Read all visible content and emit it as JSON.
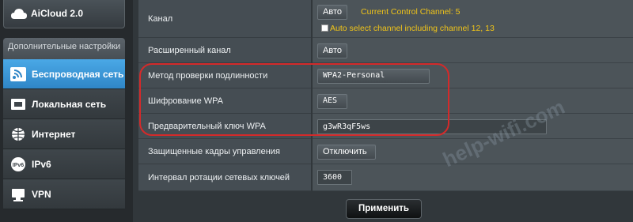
{
  "sidebar": {
    "aicloud_label": "AiCloud 2.0",
    "advanced_label": "Дополнительные настройки",
    "items": [
      {
        "label": "Беспроводная сеть",
        "icon": "wifi-icon",
        "active": true
      },
      {
        "label": "Локальная сеть",
        "icon": "home-icon",
        "active": false
      },
      {
        "label": "Интернет",
        "icon": "globe-icon",
        "active": false
      },
      {
        "label": "IPv6",
        "icon": "ipv6-icon",
        "active": false
      },
      {
        "label": "VPN",
        "icon": "vpn-icon",
        "active": false
      }
    ]
  },
  "settings": {
    "channel": {
      "label": "Канал",
      "value": "Авто",
      "current_note": "Current Control Channel: 5",
      "auto_select_note": "Auto select channel including channel 12, 13",
      "auto_select_checked": false
    },
    "ext_channel": {
      "label": "Расширенный канал",
      "value": "Авто"
    },
    "auth_method": {
      "label": "Метод проверки подлинности",
      "value": "WPA2-Personal"
    },
    "wpa_encryption": {
      "label": "Шифрование WPA",
      "value": "AES"
    },
    "wpa_key": {
      "label": "Предварительный ключ WPA",
      "value": "g3wR3qF5ws"
    },
    "pmf": {
      "label": "Защищенные кадры управления",
      "value": "Отключить"
    },
    "key_rotation": {
      "label": "Интервал ротации сетевых ключей",
      "value": "3600"
    }
  },
  "apply_label": "Применить",
  "watermark": "help-wifi.com",
  "colors": {
    "accent_blue": "#2f86c7",
    "note_yellow": "#f0c419",
    "highlight_red": "#d42a2a"
  }
}
